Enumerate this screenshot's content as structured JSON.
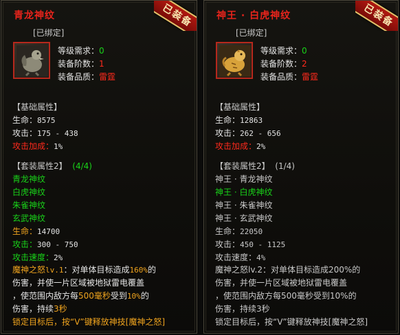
{
  "left": {
    "title": "青龙神纹",
    "bound": "[已绑定]",
    "badge": "已装备",
    "requirements": [
      {
        "label": "等级需求：",
        "value": "0"
      },
      {
        "label": "装备阶数：",
        "value": "1"
      },
      {
        "label": "装备品质：",
        "value": "雷霆"
      }
    ],
    "base_header": "【基础属性】",
    "base_stats": [
      {
        "label": "生命：",
        "value": "8575"
      },
      {
        "label": "攻击：",
        "value": "175 - 438"
      },
      {
        "label": "攻击加成：",
        "value": "1%"
      }
    ],
    "set_header": "【套装属性2】",
    "set_count": "(4/4)",
    "set_items": [
      "青龙神纹",
      "白虎神纹",
      "朱雀神纹",
      "玄武神纹"
    ],
    "set_stats": [
      {
        "label": "生命：",
        "value": "14700"
      },
      {
        "label": "攻击：",
        "value": "300 - 750"
      },
      {
        "label": "攻击速度：",
        "value": "2%"
      }
    ],
    "skill": {
      "name": "魔神之怒",
      "level": "lv.1",
      "line1_a": "：对单体目标造成",
      "line1_b": "160%",
      "line1_c": "的",
      "line2": "伤害，并使一片区域被地狱雷电覆盖",
      "line3_a": "，使范围内敌方每",
      "line3_b": "500毫秒",
      "line3_c": "受到",
      "line3_d": "10%",
      "line3_e": "的",
      "line4_a": "伤害，持续",
      "line4_b": "3秒",
      "line5": "锁定目标后，按“V”键释放神技[魔神之怒]"
    }
  },
  "right": {
    "title": "神王 · 白虎神纹",
    "bound": "[已绑定]",
    "badge": "已装备",
    "requirements": [
      {
        "label": "等级需求：",
        "value": "0"
      },
      {
        "label": "装备阶数：",
        "value": "2"
      },
      {
        "label": "装备品质：",
        "value": "雷霆"
      }
    ],
    "base_header": "【基础属性】",
    "base_stats": [
      {
        "label": "生命：",
        "value": "12863"
      },
      {
        "label": "攻击：",
        "value": "262 - 656"
      },
      {
        "label": "攻击加成：",
        "value": "2%"
      }
    ],
    "set_header": "【套装属性2】",
    "set_count": "(1/4)",
    "set_items": [
      "神王 · 青龙神纹",
      "神王 · 白虎神纹",
      "神王 · 朱雀神纹",
      "神王 · 玄武神纹"
    ],
    "set_stats": [
      {
        "label": "生命：",
        "value": "22050"
      },
      {
        "label": "攻击：",
        "value": "450 - 1125"
      },
      {
        "label": "攻击速度：",
        "value": "4%"
      }
    ],
    "skill": {
      "line1": "魔神之怒lv.2：对单体目标造成200%的",
      "line2": "伤害，并使一片区域被地狱雷电覆盖",
      "line3": "，使范围内敌方每500毫秒受到10%的",
      "line4": "伤害，持续3秒",
      "line5": "锁定目标后，按“V”键释放神技[魔神之怒]"
    }
  },
  "colors": {
    "title": "#e8241c",
    "active": "#19d319",
    "warn": "#ff2a1c",
    "highlight": "#f0a41e"
  },
  "icons": {
    "left": "dragon-emblem-icon",
    "right": "tiger-emblem-icon"
  }
}
